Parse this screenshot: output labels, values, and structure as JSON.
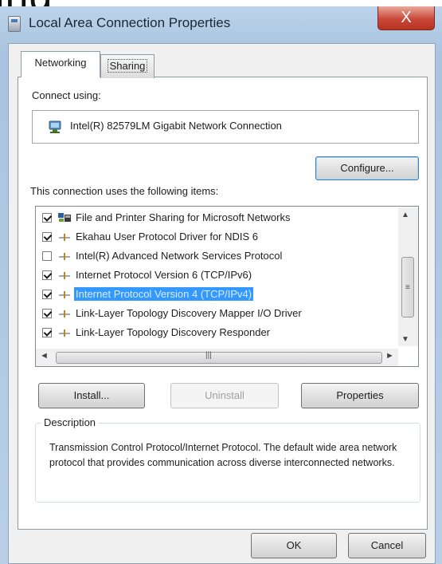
{
  "window": {
    "title": "Local Area Connection Properties",
    "close_symbol": "X"
  },
  "top_fragment": "ing",
  "tabs": [
    {
      "label": "Networking"
    },
    {
      "label": "Sharing"
    }
  ],
  "connect_using": {
    "label": "Connect using:",
    "adapter": "Intel(R) 82579LM Gigabit Network Connection",
    "configure_label": "Configure..."
  },
  "items_label": "This connection uses the following items:",
  "items": [
    {
      "label": "File and Printer Sharing for Microsoft Networks",
      "checked": true,
      "icon": "network-service-icon"
    },
    {
      "label": "Ekahau User Protocol Driver for NDIS 6",
      "checked": true,
      "icon": "protocol-icon"
    },
    {
      "label": "Intel(R) Advanced Network Services Protocol",
      "checked": false,
      "icon": "protocol-icon"
    },
    {
      "label": "Internet Protocol Version 6 (TCP/IPv6)",
      "checked": true,
      "icon": "protocol-icon"
    },
    {
      "label": "Internet Protocol Version 4 (TCP/IPv4)",
      "checked": true,
      "icon": "protocol-icon",
      "selected": true
    },
    {
      "label": "Link-Layer Topology Discovery Mapper I/O Driver",
      "checked": true,
      "icon": "protocol-icon"
    },
    {
      "label": "Link-Layer Topology Discovery Responder",
      "checked": true,
      "icon": "protocol-icon"
    }
  ],
  "buttons": {
    "install": "Install...",
    "uninstall": "Uninstall",
    "properties": "Properties",
    "ok": "OK",
    "cancel": "Cancel"
  },
  "description": {
    "legend": "Description",
    "text": "Transmission Control Protocol/Internet Protocol. The default wide area network protocol that provides communication across diverse interconnected networks."
  },
  "scroll_glyphs": {
    "up": "▲",
    "down": "▼",
    "left": "◄",
    "right": "►",
    "v_grip": "≡",
    "h_grip": "|||"
  },
  "colors": {
    "selection": "#3399ff",
    "close_button": "#c9483a",
    "frame": "#a9c4e0"
  }
}
